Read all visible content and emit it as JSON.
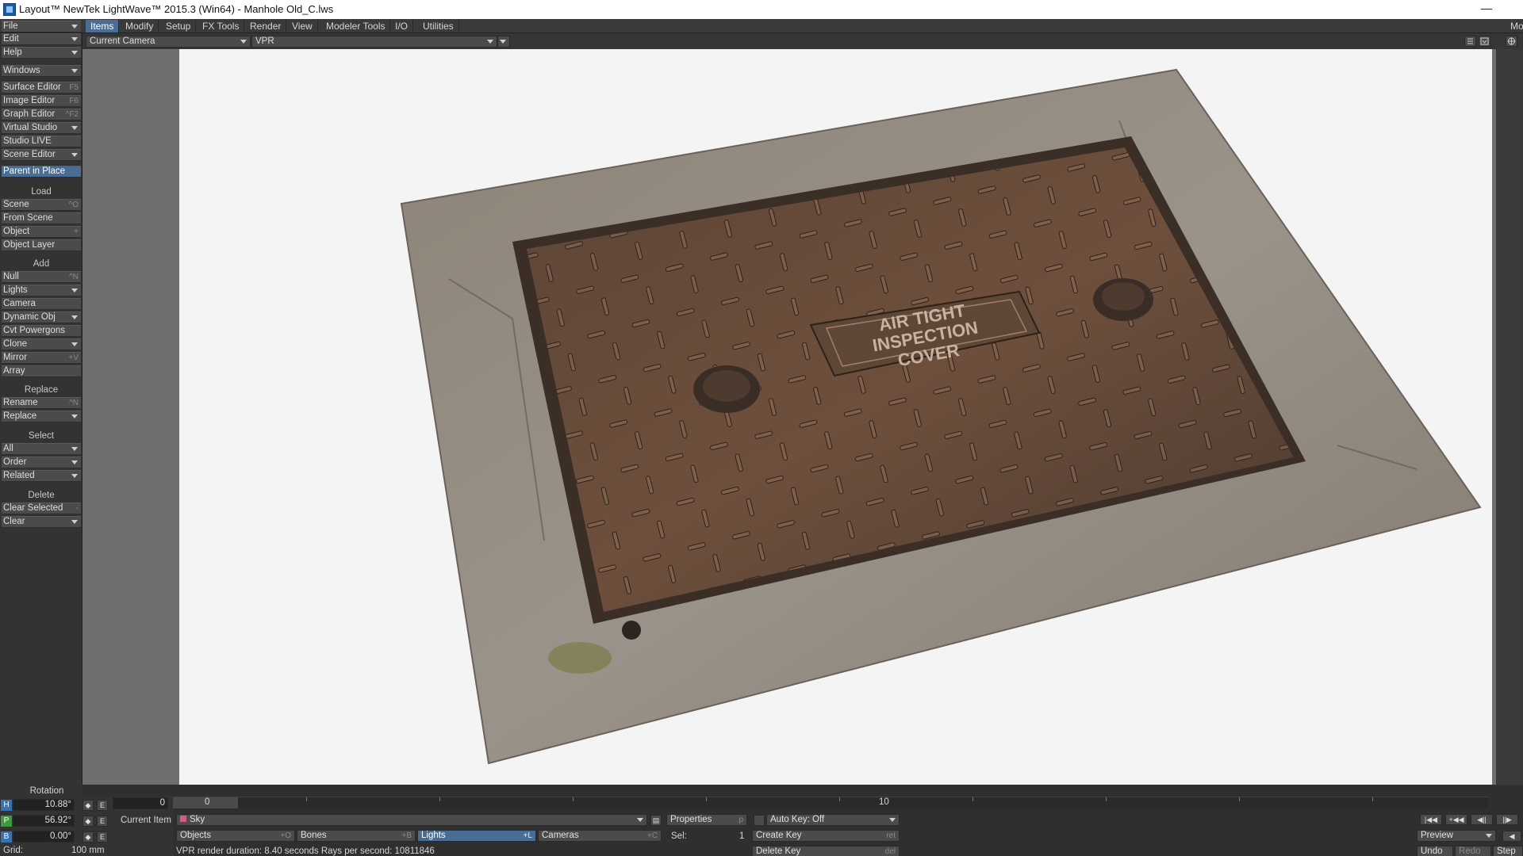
{
  "window": {
    "title": "Layout™ NewTek LightWave™ 2015.3 (Win64) - Manhole Old_C.lws",
    "min_label": "—"
  },
  "menu_tabs": [
    "Items",
    "Modify",
    "Setup",
    "FX Tools",
    "Render",
    "View",
    "Modeler Tools",
    "I/O",
    "Utilities"
  ],
  "menu_right_label": "Mo",
  "left_toolbar": {
    "top_items": [
      {
        "label": "File"
      },
      {
        "label": "Edit"
      },
      {
        "label": "Help"
      },
      {
        "label": "Windows"
      },
      {
        "label": "Surface Editor",
        "shortcut": "F5"
      },
      {
        "label": "Image Editor",
        "shortcut": "F6"
      },
      {
        "label": "Graph Editor",
        "shortcut": "^F2"
      },
      {
        "label": "Virtual Studio"
      },
      {
        "label": "Studio LIVE"
      },
      {
        "label": "Scene Editor"
      },
      {
        "label": "Parent in Place"
      }
    ],
    "load_header": "Load",
    "load_items": [
      {
        "label": "Scene",
        "shortcut": "^O"
      },
      {
        "label": "From Scene"
      },
      {
        "label": "Object",
        "shortcut": "+"
      },
      {
        "label": "Object Layer"
      }
    ],
    "add_header": "Add",
    "add_items": [
      {
        "label": "Null",
        "shortcut": "^N"
      },
      {
        "label": "Lights"
      },
      {
        "label": "Camera"
      },
      {
        "label": "Dynamic Obj"
      },
      {
        "label": "Cvt Powergons"
      },
      {
        "label": "Clone"
      },
      {
        "label": "Mirror",
        "shortcut": "+V"
      },
      {
        "label": "Array"
      }
    ],
    "replace_header": "Replace",
    "replace_items": [
      {
        "label": "Rename",
        "shortcut": "^N"
      },
      {
        "label": "Replace"
      }
    ],
    "select_header": "Select",
    "select_items": [
      {
        "label": "All"
      },
      {
        "label": "Order"
      },
      {
        "label": "Related"
      }
    ],
    "delete_header": "Delete",
    "delete_items": [
      {
        "label": "Clear Selected",
        "shortcut": "-"
      },
      {
        "label": "Clear"
      }
    ]
  },
  "viewport": {
    "camera_select": "Current Camera",
    "render_mode": "VPR"
  },
  "transform": {
    "header": "Rotation",
    "h_label": "H",
    "h_value": "10.88°",
    "p_label": "P",
    "p_value": "56.92°",
    "b_label": "B",
    "b_value": "0.00°",
    "e_label": "E",
    "grid_label": "Grid:",
    "grid_value": "100 mm"
  },
  "timeline": {
    "frame_field": "0",
    "current_frame": "0",
    "marker_10": "10"
  },
  "item_bar": {
    "current_item_label": "Current Item",
    "current_item_value": "Sky",
    "properties_label": "Properties",
    "properties_shortcut": "p",
    "auto_key": "Auto Key: Off",
    "objects_label": "Objects",
    "objects_shortcut": "+O",
    "bones_label": "Bones",
    "bones_shortcut": "+B",
    "lights_label": "Lights",
    "lights_shortcut": "+L",
    "cameras_label": "Cameras",
    "cameras_shortcut": "+C",
    "sel_label": "Sel:",
    "sel_value": "1",
    "create_key": "Create Key",
    "create_key_shortcut": "ret",
    "delete_key": "Delete Key",
    "delete_key_shortcut": "del",
    "status": "VPR render duration: 8.40 seconds  Rays per second: 10811846",
    "preview": "Preview",
    "undo": "Undo ^Z",
    "redo": "Redo",
    "step": "Step"
  },
  "scene": {
    "cover_line1": "AIR TIGHT",
    "cover_line2": "INSPECTION",
    "cover_line3": "COVER"
  }
}
